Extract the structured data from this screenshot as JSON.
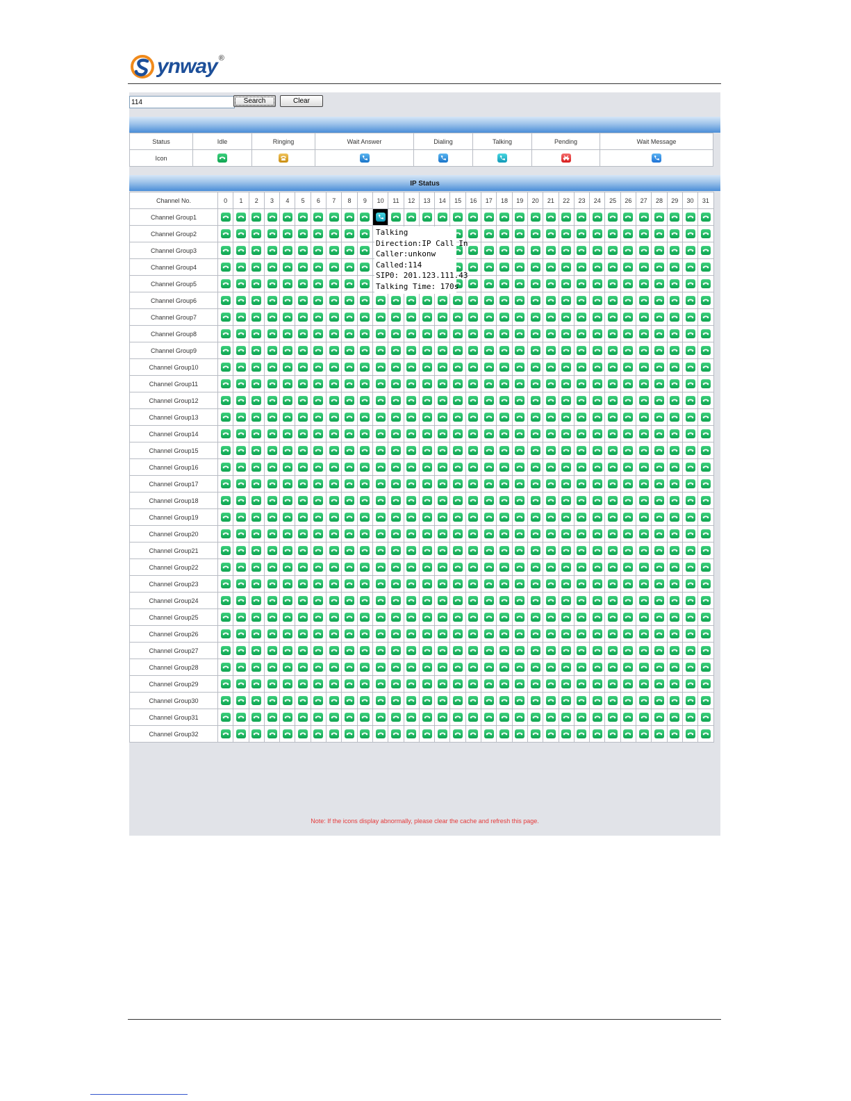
{
  "brand": {
    "name": "ynway",
    "registered": "®"
  },
  "search": {
    "value": "114",
    "search_label": "Search",
    "clear_label": "Clear"
  },
  "legend": {
    "status_label": "Status",
    "icon_label": "Icon",
    "statuses": [
      {
        "name": "Idle",
        "icon": "idle-phone-icon",
        "color": "#1aae5c"
      },
      {
        "name": "Ringing",
        "icon": "ringing-phone-icon",
        "color": "#d9a028"
      },
      {
        "name": "Wait Answer",
        "icon": "wait-answer-phone-icon",
        "color": "#2a88d8"
      },
      {
        "name": "Dialing",
        "icon": "dialing-phone-icon",
        "color": "#2a88d8"
      },
      {
        "name": "Talking",
        "icon": "talking-phone-icon",
        "color": "#1aa8c4"
      },
      {
        "name": "Pending",
        "icon": "pending-phone-icon",
        "color": "#e02a2a"
      },
      {
        "name": "Wait Message",
        "icon": "wait-message-phone-icon",
        "color": "#2a7fe0"
      }
    ]
  },
  "ip_status": {
    "title": "IP Status",
    "channel_no_label": "Channel No.",
    "channels": [
      "0",
      "1",
      "2",
      "3",
      "4",
      "5",
      "6",
      "7",
      "8",
      "9",
      "10",
      "11",
      "12",
      "13",
      "14",
      "15",
      "16",
      "17",
      "18",
      "19",
      "20",
      "21",
      "22",
      "23",
      "24",
      "25",
      "26",
      "27",
      "28",
      "29",
      "30",
      "31"
    ],
    "groups": [
      "Channel Group1",
      "Channel Group2",
      "Channel Group3",
      "Channel Group4",
      "Channel Group5",
      "Channel Group6",
      "Channel Group7",
      "Channel Group8",
      "Channel Group9",
      "Channel Group10",
      "Channel Group11",
      "Channel Group12",
      "Channel Group13",
      "Channel Group14",
      "Channel Group15",
      "Channel Group16",
      "Channel Group17",
      "Channel Group18",
      "Channel Group19",
      "Channel Group20",
      "Channel Group21",
      "Channel Group22",
      "Channel Group23",
      "Channel Group24",
      "Channel Group25",
      "Channel Group26",
      "Channel Group27",
      "Channel Group28",
      "Channel Group29",
      "Channel Group30",
      "Channel Group31",
      "Channel Group32"
    ],
    "default_status": "idle",
    "special_cells": [
      {
        "group": 0,
        "channel": 10,
        "status": "talking",
        "selected": true
      }
    ]
  },
  "tooltip": {
    "lines": [
      "Talking",
      "Direction:IP Call In",
      "Caller:unkonw",
      "Called:114",
      "SIP0: 201.123.111.43",
      "Talking Time: 170s"
    ]
  },
  "note": "Note: If the icons display abnormally, please clear the cache and refresh this page."
}
